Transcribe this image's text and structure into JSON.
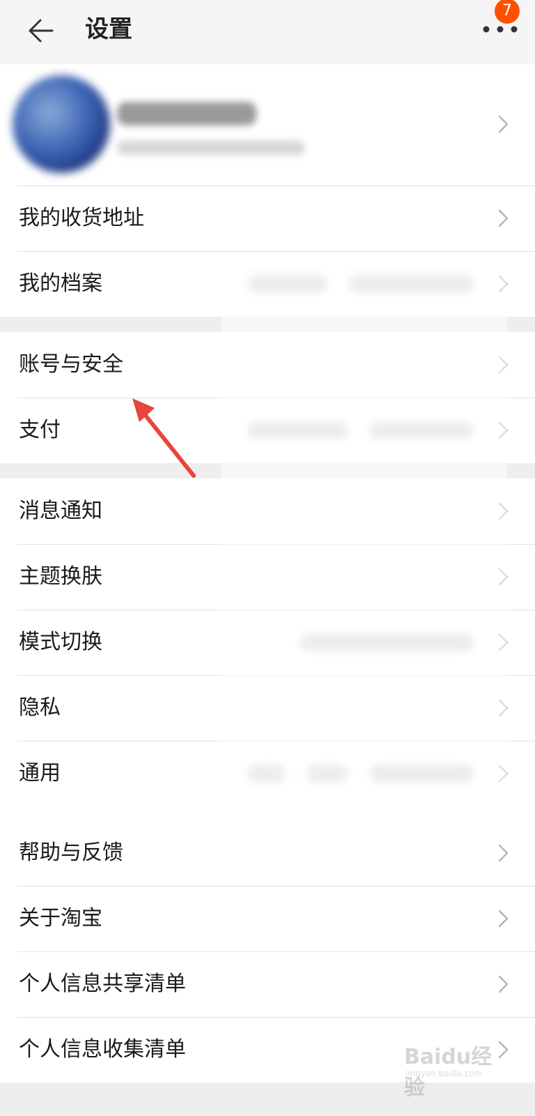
{
  "header": {
    "title": "设置",
    "badge_count": "7"
  },
  "profile": {
    "blurred": true
  },
  "groups": [
    {
      "items": [
        {
          "label": "我的收货地址"
        },
        {
          "label": "我的档案"
        }
      ]
    },
    {
      "items": [
        {
          "label": "账号与安全"
        },
        {
          "label": "支付"
        }
      ]
    },
    {
      "items": [
        {
          "label": "消息通知"
        },
        {
          "label": "主题换肤"
        },
        {
          "label": "模式切换"
        },
        {
          "label": "隐私"
        },
        {
          "label": "通用"
        }
      ]
    },
    {
      "items": [
        {
          "label": "帮助与反馈"
        },
        {
          "label": "关于淘宝"
        },
        {
          "label": "个人信息共享清单"
        },
        {
          "label": "个人信息收集清单"
        }
      ]
    }
  ],
  "annotation": {
    "arrow_color": "#e8453c",
    "target": "账号与安全"
  },
  "watermark": {
    "text": "Baidu经验",
    "sub": "jingyan.baidu.com"
  },
  "colors": {
    "accent": "#ff5000",
    "background": "#eeeeee"
  }
}
